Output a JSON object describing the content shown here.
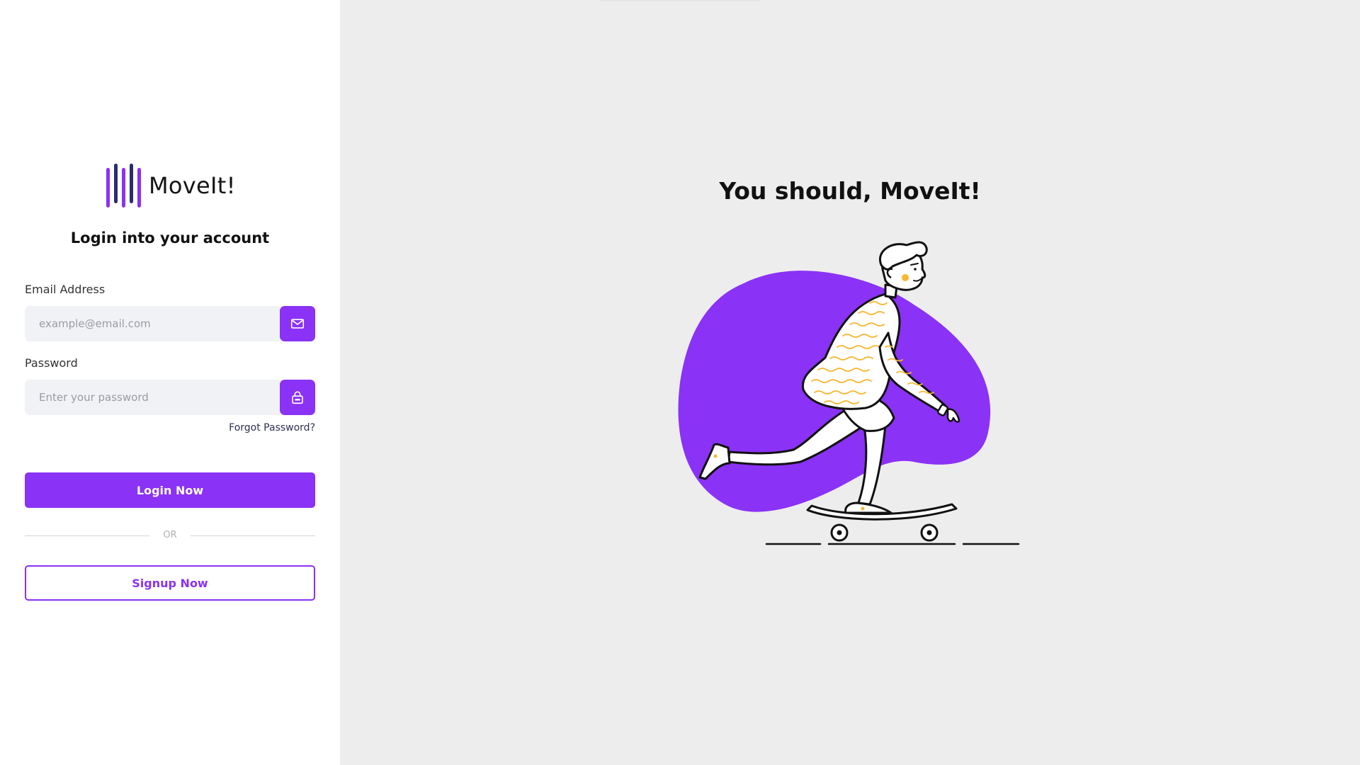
{
  "brand": {
    "name": "MoveIt!",
    "logo_icon": "vertical-bars-logo-icon"
  },
  "login": {
    "heading": "Login into your account",
    "email": {
      "label": "Email Address",
      "placeholder": "example@email.com",
      "value": "",
      "icon": "mail-icon"
    },
    "password": {
      "label": "Password",
      "placeholder": "Enter your password",
      "value": "",
      "icon": "lock-icon"
    },
    "forgot_label": "Forgot Password?",
    "login_label": "Login Now",
    "divider_label": "OR",
    "signup_label": "Signup Now"
  },
  "hero": {
    "title": "You should, MoveIt!",
    "illustration": "person-skateboarding-illustration"
  },
  "colors": {
    "accent": "#8a32f5",
    "logo_dark": "#2a2d6e",
    "input_bg": "#f1f2f5",
    "page_bg": "#ededed",
    "shirt_stripes": "#f7b733"
  }
}
